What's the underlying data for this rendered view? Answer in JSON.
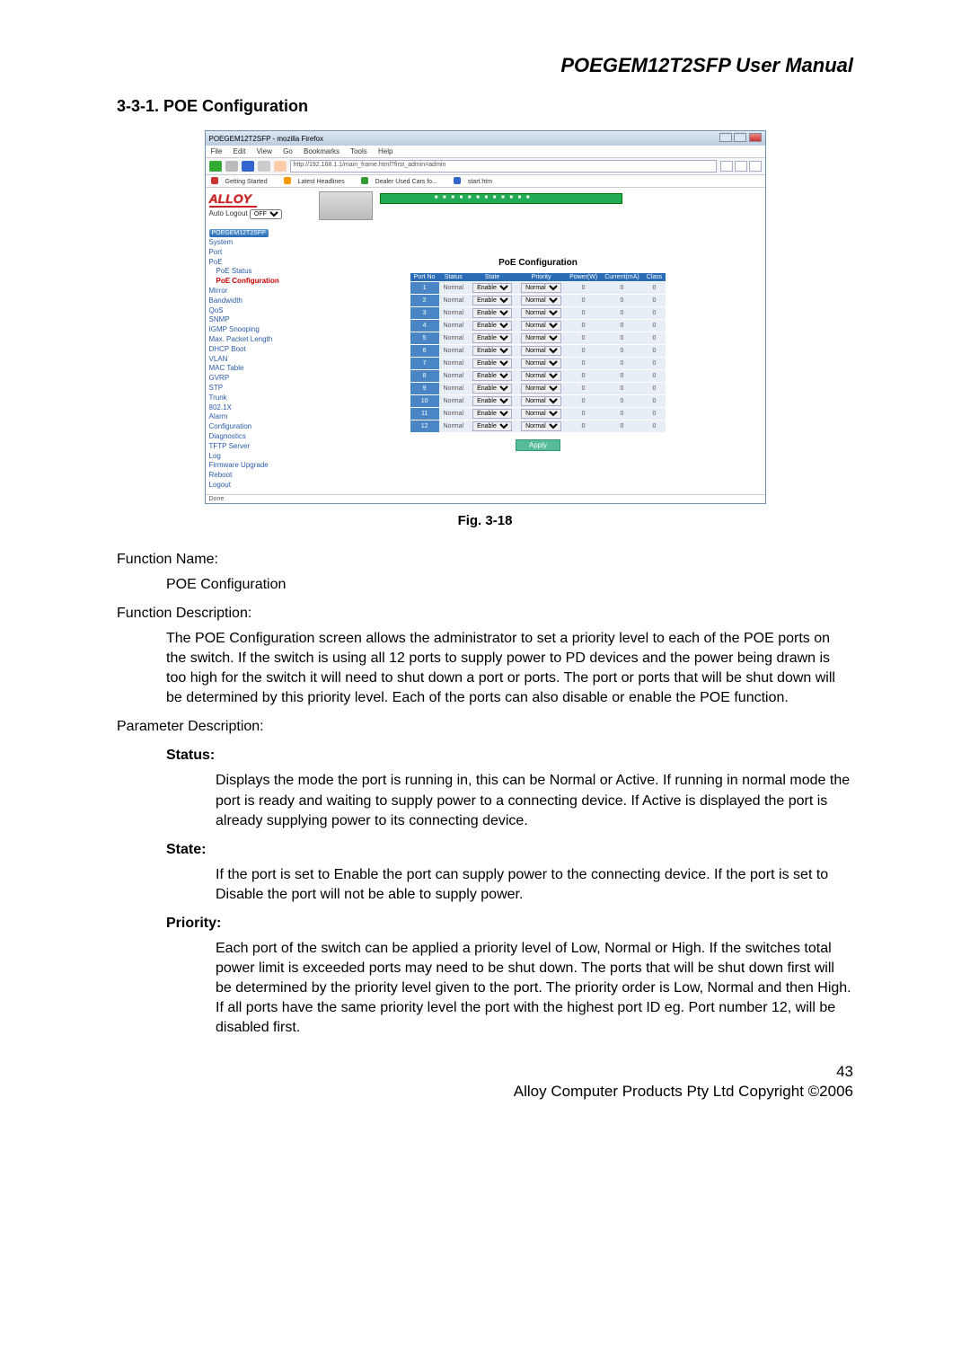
{
  "header": {
    "manual_title": "POEGEM12T2SFP User Manual",
    "section": "3-3-1. POE Configuration"
  },
  "browser": {
    "window_title": "POEGEM12T2SFP - mozilla Firefox",
    "menus": [
      "File",
      "Edit",
      "View",
      "Go",
      "Bookmarks",
      "Tools",
      "Help"
    ],
    "url": "http://192.168.1.1/main_frame.html?first_admin=admin",
    "bookmarks": [
      "Getting Started",
      "Latest Headlines",
      "Dealer Used Cars fo...",
      "start.htm"
    ]
  },
  "sidebar": {
    "logo": "ALLOY",
    "autologout_label": "Auto Logout",
    "autologout_value": "OFF",
    "device": "POEGEM12T2SFP",
    "items": [
      {
        "label": "System",
        "sub": false,
        "sel": false
      },
      {
        "label": "Port",
        "sub": false,
        "sel": false
      },
      {
        "label": "PoE",
        "sub": false,
        "sel": false
      },
      {
        "label": "PoE Status",
        "sub": true,
        "sel": false
      },
      {
        "label": "PoE Configuration",
        "sub": true,
        "sel": true
      },
      {
        "label": "Mirror",
        "sub": false,
        "sel": false
      },
      {
        "label": "Bandwidth",
        "sub": false,
        "sel": false
      },
      {
        "label": "QoS",
        "sub": false,
        "sel": false
      },
      {
        "label": "SNMP",
        "sub": false,
        "sel": false
      },
      {
        "label": "IGMP Snooping",
        "sub": false,
        "sel": false
      },
      {
        "label": "Max. Packet Length",
        "sub": false,
        "sel": false
      },
      {
        "label": "DHCP Boot",
        "sub": false,
        "sel": false
      },
      {
        "label": "VLAN",
        "sub": false,
        "sel": false
      },
      {
        "label": "MAC Table",
        "sub": false,
        "sel": false
      },
      {
        "label": "GVRP",
        "sub": false,
        "sel": false
      },
      {
        "label": "STP",
        "sub": false,
        "sel": false
      },
      {
        "label": "Trunk",
        "sub": false,
        "sel": false
      },
      {
        "label": "802.1X",
        "sub": false,
        "sel": false
      },
      {
        "label": "Alarm",
        "sub": false,
        "sel": false
      },
      {
        "label": "Configuration",
        "sub": false,
        "sel": false
      },
      {
        "label": "Diagnostics",
        "sub": false,
        "sel": false
      },
      {
        "label": "TFTP Server",
        "sub": false,
        "sel": false
      },
      {
        "label": "Log",
        "sub": false,
        "sel": false
      },
      {
        "label": "Firmware Upgrade",
        "sub": false,
        "sel": false
      },
      {
        "label": "Reboot",
        "sub": false,
        "sel": false
      },
      {
        "label": "Logout",
        "sub": false,
        "sel": false
      }
    ]
  },
  "panel": {
    "title": "PoE Configuration",
    "headers": [
      "Port No",
      "Status",
      "State",
      "Priority",
      "Power(W)",
      "Current(mA)",
      "Class"
    ],
    "rows": [
      {
        "port": "1",
        "status": "Normal",
        "state": "Enable",
        "priority": "Normal",
        "power": "0",
        "current": "0",
        "class": "0"
      },
      {
        "port": "2",
        "status": "Normal",
        "state": "Enable",
        "priority": "Normal",
        "power": "0",
        "current": "0",
        "class": "0"
      },
      {
        "port": "3",
        "status": "Normal",
        "state": "Enable",
        "priority": "Normal",
        "power": "0",
        "current": "0",
        "class": "0"
      },
      {
        "port": "4",
        "status": "Normal",
        "state": "Enable",
        "priority": "Normal",
        "power": "0",
        "current": "0",
        "class": "0"
      },
      {
        "port": "5",
        "status": "Normal",
        "state": "Enable",
        "priority": "Normal",
        "power": "0",
        "current": "0",
        "class": "0"
      },
      {
        "port": "6",
        "status": "Normal",
        "state": "Enable",
        "priority": "Normal",
        "power": "0",
        "current": "0",
        "class": "0"
      },
      {
        "port": "7",
        "status": "Normal",
        "state": "Enable",
        "priority": "Normal",
        "power": "0",
        "current": "0",
        "class": "0"
      },
      {
        "port": "8",
        "status": "Normal",
        "state": "Enable",
        "priority": "Normal",
        "power": "0",
        "current": "0",
        "class": "0"
      },
      {
        "port": "9",
        "status": "Normal",
        "state": "Enable",
        "priority": "Normal",
        "power": "0",
        "current": "0",
        "class": "0"
      },
      {
        "port": "10",
        "status": "Normal",
        "state": "Enable",
        "priority": "Normal",
        "power": "0",
        "current": "0",
        "class": "0"
      },
      {
        "port": "11",
        "status": "Normal",
        "state": "Enable",
        "priority": "Normal",
        "power": "0",
        "current": "0",
        "class": "0"
      },
      {
        "port": "12",
        "status": "Normal",
        "state": "Enable",
        "priority": "Normal",
        "power": "0",
        "current": "0",
        "class": "0"
      }
    ],
    "apply": "Apply",
    "statusbar": "Done"
  },
  "figure_caption": "Fig. 3-18",
  "text": {
    "fn_label": "Function Name:",
    "fn_value": "POE Configuration",
    "fd_label": "Function Description:",
    "fd_value": "The POE Configuration screen allows the administrator to set a priority level to each of the POE ports on the switch. If the switch is using all 12 ports to supply power to PD devices and the power being drawn is too high for the switch it will need to shut down a port or ports. The port or ports that will be shut down will be determined by this priority level.  Each of the ports can also disable or enable the POE function.",
    "pd_label": "Parameter Description:",
    "status_h": "Status:",
    "status_t": "Displays the mode the port is running in, this can be Normal or Active. If running in normal mode the port is ready and waiting to supply power to a connecting device. If Active is displayed the port is already supplying power to its connecting device.",
    "state_h": "State:",
    "state_t": "If the port is set to Enable the port can supply power to the connecting device. If the port is set to Disable the port will not be able to supply power.",
    "prio_h": "Priority:",
    "prio_t": "Each port of the switch can be applied a priority level of Low, Normal or High. If the switches total power limit is exceeded ports may need to be shut down. The ports that will be shut down first will be determined by the priority level given to the port. The priority order is Low, Normal and then High. If all ports have the same priority level the port with the highest port ID eg. Port number 12, will be disabled first."
  },
  "footer": {
    "page": "43",
    "copyright": "Alloy Computer Products Pty Ltd Copyright ©2006"
  }
}
